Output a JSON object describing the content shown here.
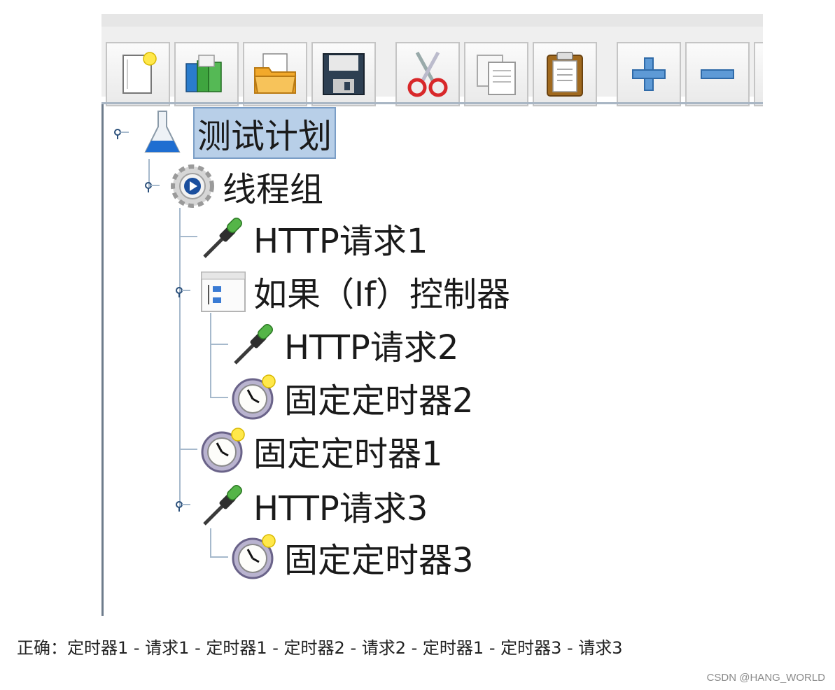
{
  "tree": {
    "nodes": [
      {
        "label": "测试计划",
        "icon": "beaker-icon"
      },
      {
        "label": "线程组",
        "icon": "thread-group-gear-icon"
      },
      {
        "label": "HTTP请求1",
        "icon": "dropper-icon"
      },
      {
        "label": "如果（If）控制器",
        "icon": "if-controller-icon"
      },
      {
        "label": "HTTP请求2",
        "icon": "dropper-icon"
      },
      {
        "label": "固定定时器2",
        "icon": "timer-clock-icon"
      },
      {
        "label": "固定定时器1",
        "icon": "timer-clock-icon"
      },
      {
        "label": "HTTP请求3",
        "icon": "dropper-icon"
      },
      {
        "label": "固定定时器3",
        "icon": "timer-clock-icon"
      }
    ]
  },
  "toolbar": {
    "buttons": [
      {
        "icon": "new-file-icon"
      },
      {
        "icon": "templates-icon"
      },
      {
        "icon": "open-folder-icon"
      },
      {
        "icon": "save-floppy-icon"
      },
      {
        "icon": "cut-scissors-icon"
      },
      {
        "icon": "copy-icon"
      },
      {
        "icon": "paste-clipboard-icon"
      },
      {
        "icon": "expand-plus-icon"
      },
      {
        "icon": "collapse-minus-icon"
      }
    ]
  },
  "caption": "正确：定时器1 - 请求1 - 定时器1 - 定时器2 - 请求2 - 定时器1 - 定时器3 - 请求3",
  "credit": "CSDN @HANG_WORLD",
  "colors": {
    "selection": "#b8cfe8",
    "tree_line": "#a6b9cc"
  }
}
